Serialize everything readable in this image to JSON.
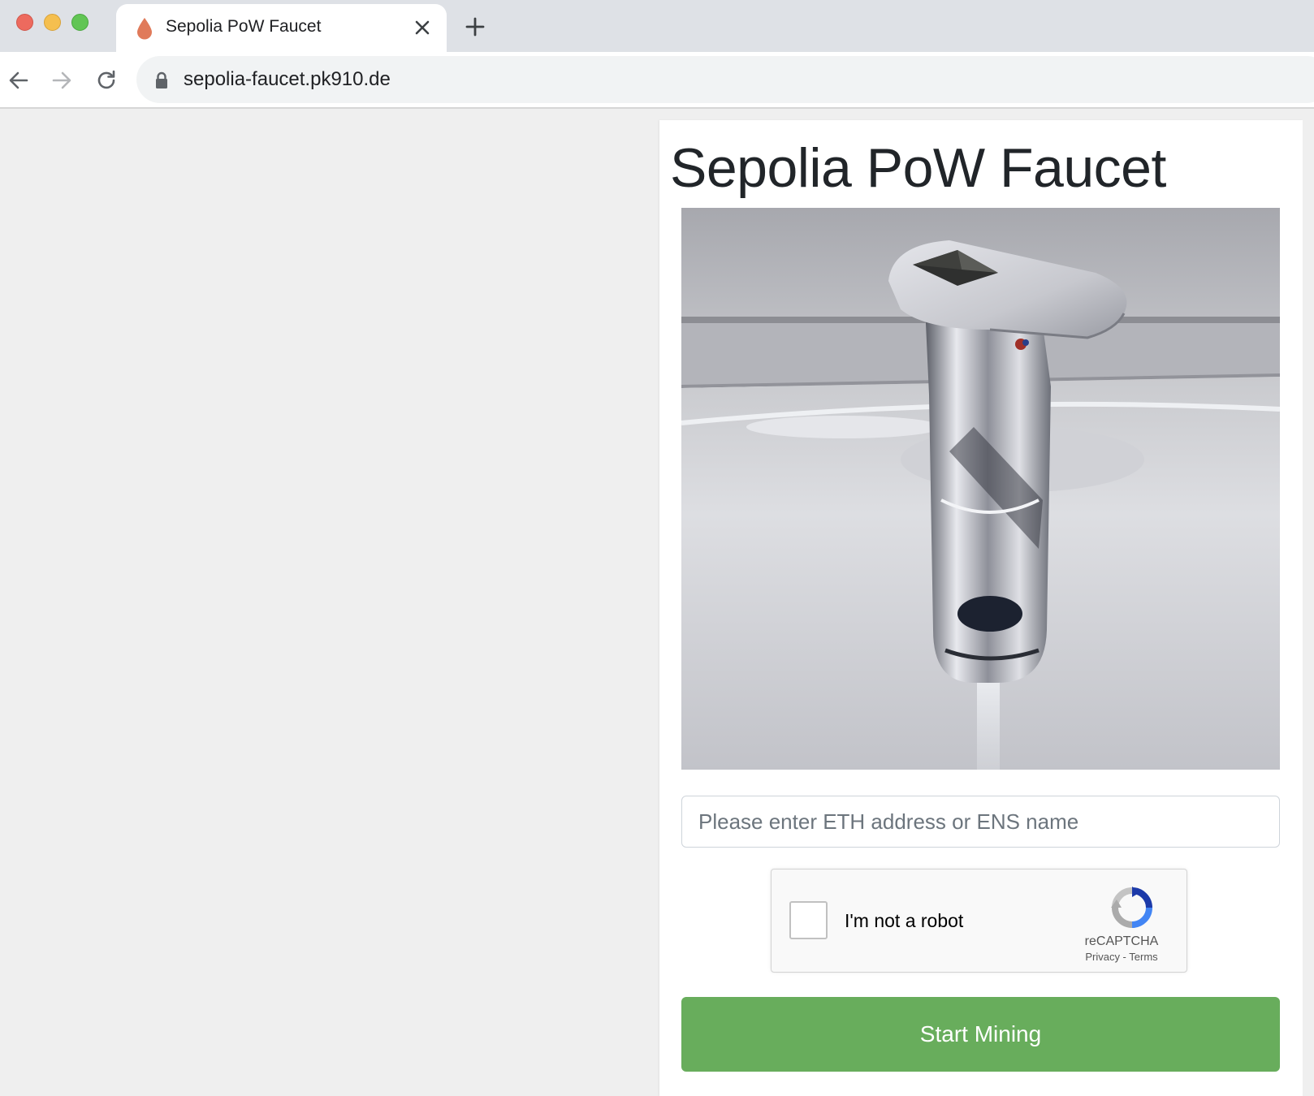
{
  "browser": {
    "tab_title": "Sepolia PoW Faucet",
    "url": "sepolia-faucet.pk910.de"
  },
  "page": {
    "title": "Sepolia PoW Faucet",
    "address_input": {
      "value": "",
      "placeholder": "Please enter ETH address or ENS name"
    },
    "recaptcha": {
      "checkbox_label": "I'm not a robot",
      "brand": "reCAPTCHA",
      "links": "Privacy - Terms",
      "checked": false
    },
    "start_button_label": "Start Mining"
  },
  "icons": {
    "tab_favicon": "droplet-icon",
    "tab_close": "close-icon",
    "new_tab": "plus-icon",
    "back": "arrow-left-icon",
    "forward": "arrow-right-icon",
    "reload": "reload-icon",
    "lock": "lock-icon",
    "recaptcha_logo": "recaptcha-logo-icon"
  },
  "colors": {
    "start_button": "#68ad5c",
    "favicon": "#e07a5a",
    "page_background": "#efefef"
  }
}
